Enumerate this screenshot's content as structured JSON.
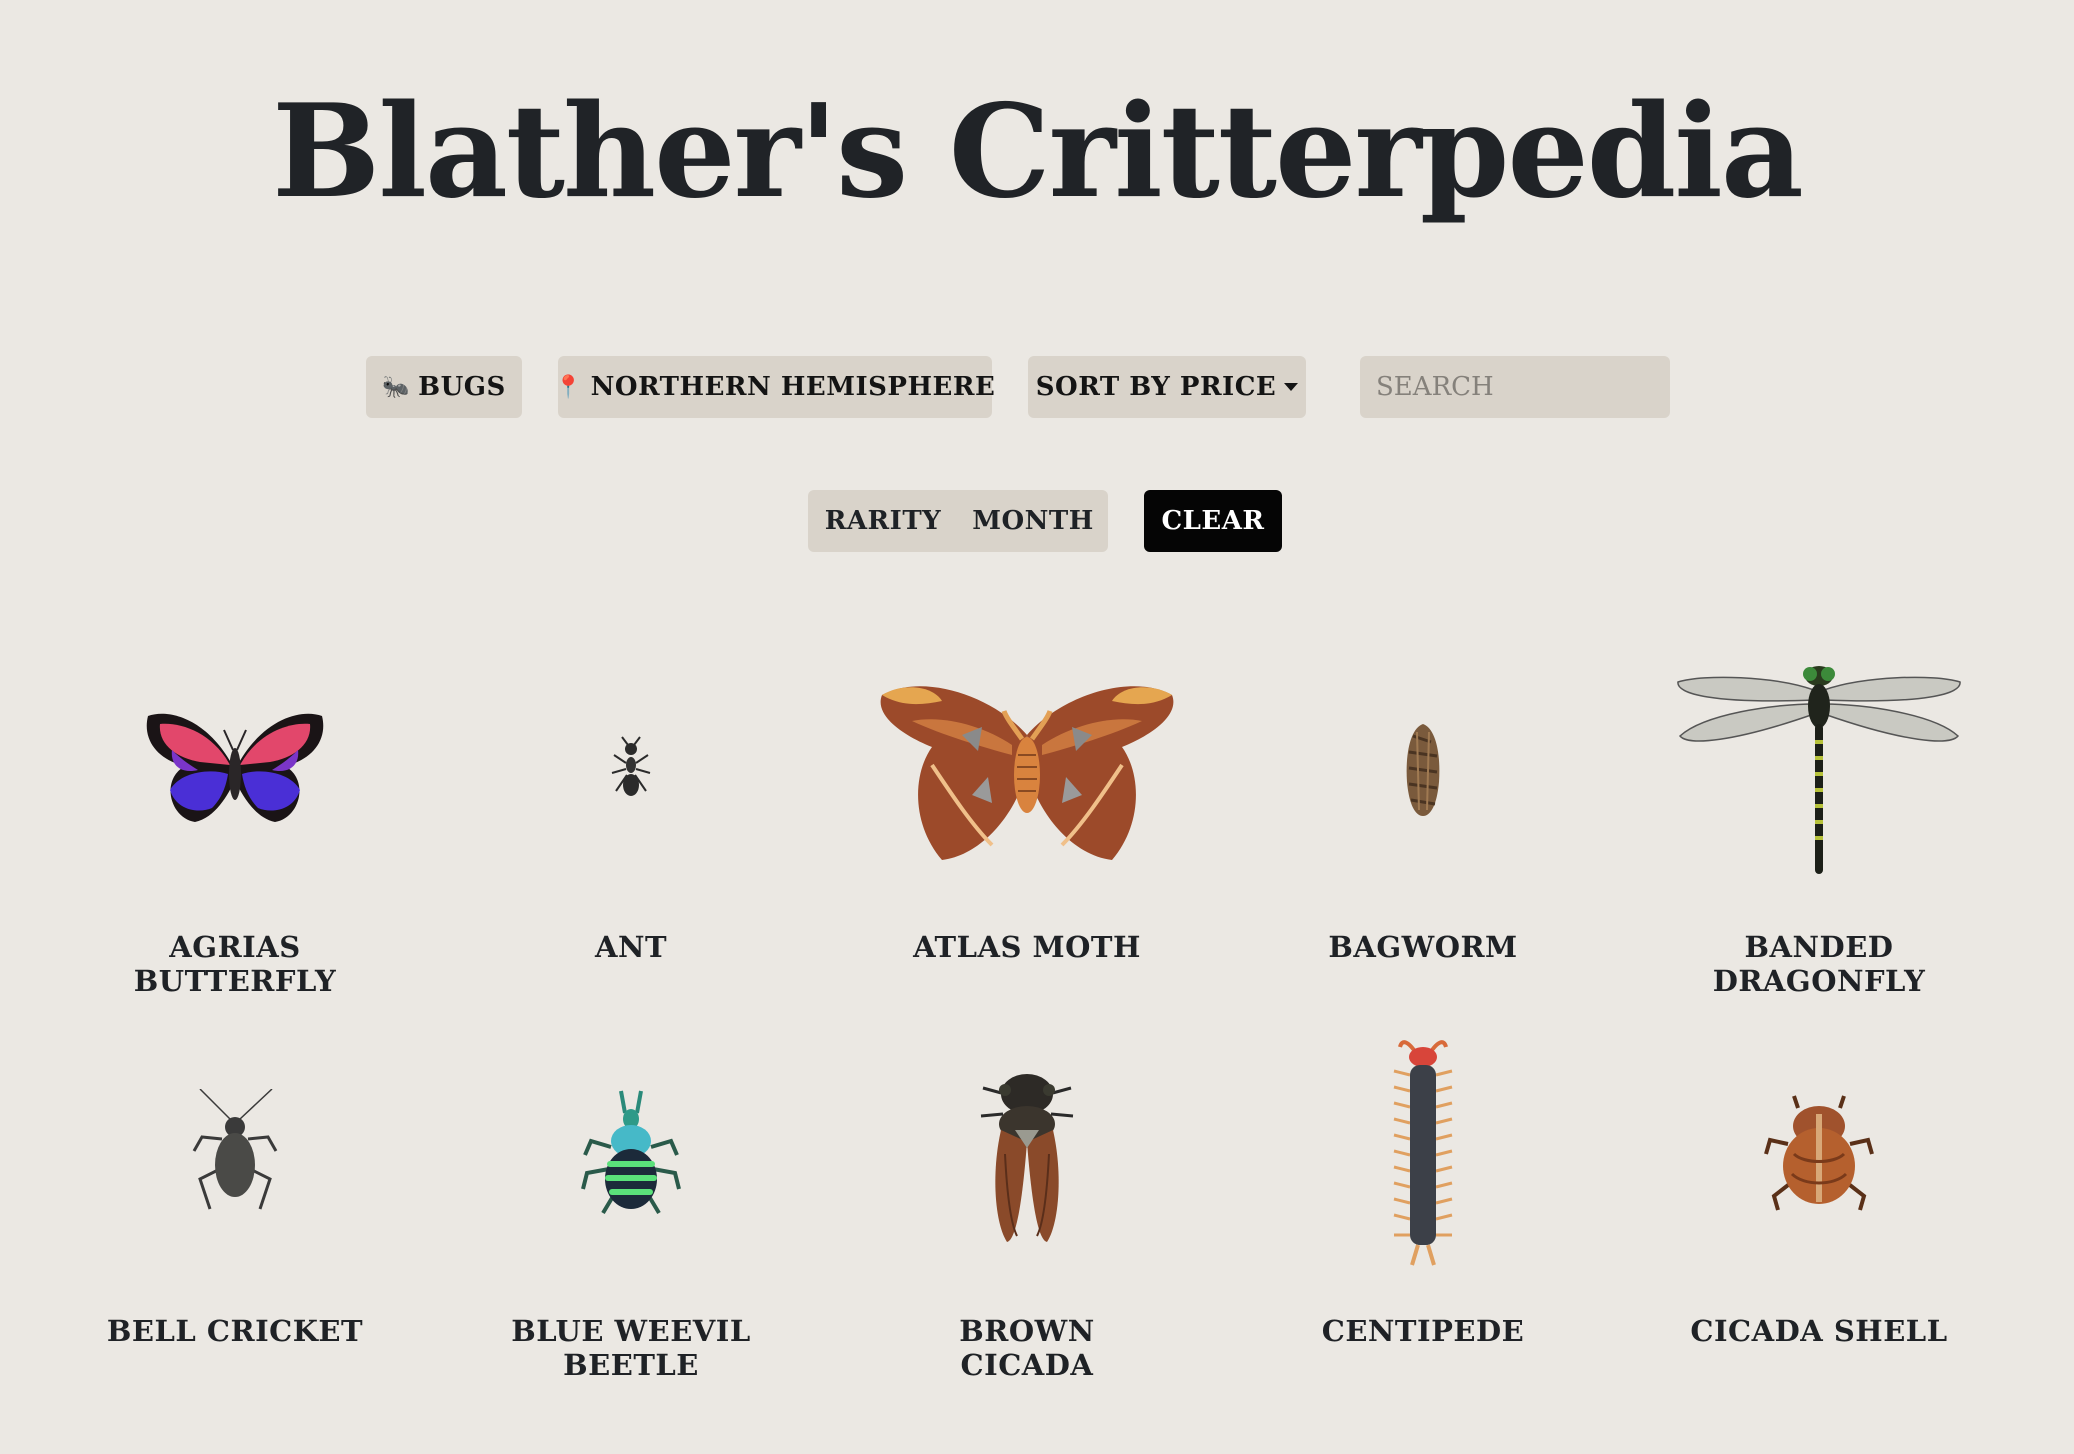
{
  "page": {
    "title": "Blather's Critterpedia"
  },
  "filters": {
    "category_label": "BUGS",
    "category_icon": "ant-icon",
    "hemisphere_label": "NORTHERN HEMISPHERE",
    "hemisphere_icon": "map-pin-icon",
    "sort_label": "SORT BY PRICE",
    "search_placeholder": "SEARCH",
    "search_value": ""
  },
  "toggles": {
    "rarity_label": "RARITY",
    "month_label": "MONTH",
    "clear_label": "CLEAR"
  },
  "critters": [
    {
      "name": "AGRIAS BUTTERFLY",
      "icon": "butterfly-icon"
    },
    {
      "name": "ANT",
      "icon": "ant-icon"
    },
    {
      "name": "ATLAS MOTH",
      "icon": "moth-icon"
    },
    {
      "name": "BAGWORM",
      "icon": "bagworm-icon"
    },
    {
      "name": "BANDED DRAGONFLY",
      "icon": "dragonfly-icon"
    },
    {
      "name": "BELL CRICKET",
      "icon": "cricket-icon"
    },
    {
      "name": "BLUE WEEVIL BEETLE",
      "icon": "weevil-icon"
    },
    {
      "name": "BROWN CICADA",
      "icon": "cicada-icon"
    },
    {
      "name": "CENTIPEDE",
      "icon": "centipede-icon"
    },
    {
      "name": "CICADA SHELL",
      "icon": "cicada-shell-icon"
    }
  ],
  "colors": {
    "background": "#ebe8e3",
    "button": "#d9d3ca",
    "clear_button": "#050505",
    "text": "#1f2226"
  }
}
